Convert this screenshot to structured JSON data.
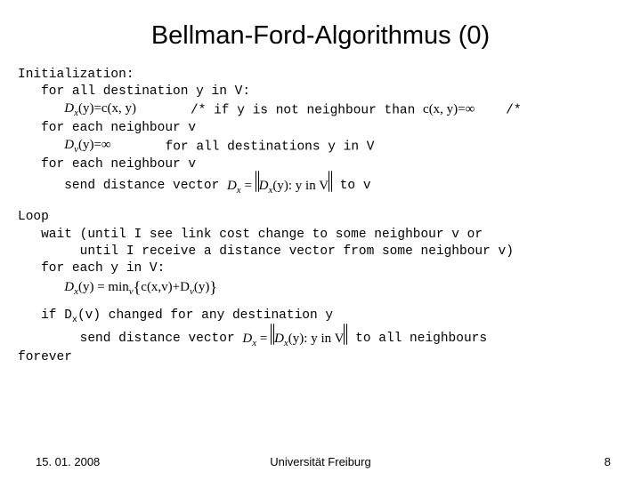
{
  "title": "Bellman-Ford-Algorithmus (0)",
  "init": {
    "heading": "Initialization:",
    "for_dest": "for all destination y in V:",
    "eq1_left": "D",
    "eq1_sub": "x",
    "eq1_arg": "(y)=c(x, y)",
    "comment1a": "/* if y is not neighbour than ",
    "eq1b_left": "c(x, y)=∞",
    "comment1b": " /*",
    "for_nb1": "for each neighbour v",
    "eq2_left": "D",
    "eq2_sub": "v",
    "eq2_arg": "(y)=∞",
    "for_all_dest": "for all destinations y in V",
    "for_nb2": "for each neighbour v",
    "send_dv": "send distance vector ",
    "eq3_left": "D",
    "eq3_sub": "x",
    "eq3_eq": " = ",
    "eq3_inner": "D",
    "eq3_inner_sub": "x",
    "eq3_inner_arg": "(y): y in V",
    "to_v": " to v"
  },
  "loop": {
    "heading": "Loop",
    "wait1": "wait (until I see link cost change to some neighbour v or",
    "wait2": "until I receive a distance vector from some neighbour v)",
    "for_y": "for each y in V:",
    "eq4_lhs": "D",
    "eq4_sub": "x",
    "eq4_arg": "(y) = min",
    "eq4_minsub": "v",
    "eq4_br_inner1": "c(x,v)+D",
    "eq4_br_inner_sub": "v",
    "eq4_br_inner2": "(y)",
    "if_line_a": "if D",
    "if_line_sub": "x",
    "if_line_b": "(v) changed for any destination y",
    "send2": "send distance vector ",
    "eq5_inner": "D",
    "eq5_inner_sub": "x",
    "eq5_inner_arg": "(y): y in V",
    "to_all": " to all neighbours",
    "forever": "forever"
  },
  "footer": {
    "date": "15. 01. 2008",
    "uni": "Universität Freiburg",
    "page": "8"
  }
}
